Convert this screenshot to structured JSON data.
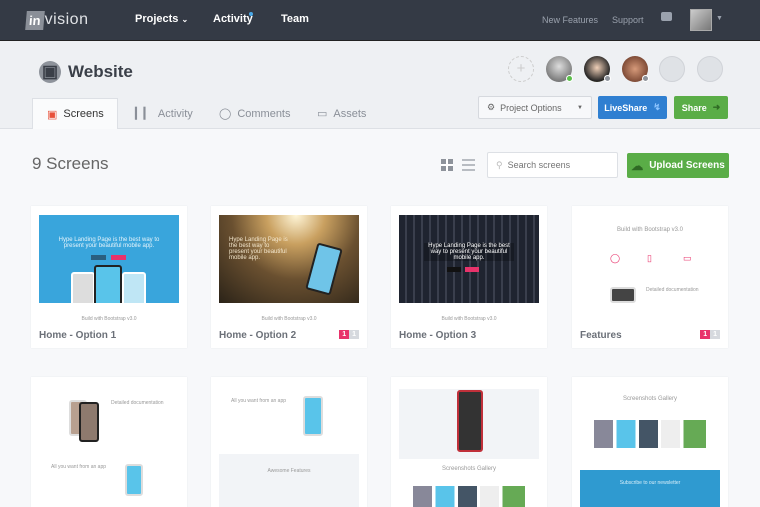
{
  "nav": {
    "logo_box": "in",
    "logo_text": "vision",
    "items": [
      {
        "label": "Projects",
        "icon": "chevron-down"
      },
      {
        "label": "Activity",
        "has_notification": true
      },
      {
        "label": "Team"
      }
    ],
    "right": [
      {
        "label": "New Features"
      },
      {
        "label": "Support"
      }
    ],
    "camera_icon": "camera-icon"
  },
  "project": {
    "title": "Website",
    "icon": "monitor-icon"
  },
  "collaborators": [
    {
      "status": "online",
      "status_color": "#5bbf4a"
    },
    {
      "status": "away",
      "status_color": "#8e939b"
    },
    {
      "status": "away",
      "status_color": "#8e939b"
    },
    {
      "status": "invited"
    },
    {
      "status": "invited"
    }
  ],
  "tabs": [
    {
      "label": "Screens",
      "icon": "monitor-icon",
      "active": true
    },
    {
      "label": "Activity",
      "icon": "bar-chart-icon"
    },
    {
      "label": "Comments",
      "icon": "comment-icon"
    },
    {
      "label": "Assets",
      "icon": "folder-icon"
    }
  ],
  "toolbar": {
    "project_options": "Project Options",
    "liveshare": "LiveShare",
    "share": "Share"
  },
  "screens": {
    "count_label": "9 Screens",
    "search_placeholder": "Search screens",
    "upload_label": "Upload Screens"
  },
  "colors": {
    "nav": "#343a45",
    "liveshare": "#2f7fd1",
    "share": "#5aad47",
    "badge": "#e8336b"
  },
  "cards": [
    {
      "title": "Home - Option 1",
      "thumb_text": "Hype Landing Page is the best way to present your beautiful mobile app.",
      "footer_text": "Build with Bootstrap v3.0"
    },
    {
      "title": "Home - Option 2",
      "thumb_text": "Hype Landing Page is the best way to present your beautiful mobile app.",
      "footer_text": "Build with Bootstrap v3.0",
      "badge": [
        "1",
        "1"
      ]
    },
    {
      "title": "Home - Option 3",
      "thumb_text": "Hype Landing Page is the best way to present your beautiful mobile app.",
      "footer_text": "Build with Bootstrap v3.0"
    },
    {
      "title": "Features",
      "thumb_text": "Build with Bootstrap v3.0",
      "footer_text": "Detailed documentation",
      "badge": [
        "1",
        "1"
      ]
    },
    {
      "thumb_text": "Detailed documentation",
      "footer_text": "All you want from an app"
    },
    {
      "thumb_text": "All you want from an app",
      "footer_text": "Awesome Features"
    },
    {
      "thumb_text": "Screenshots Gallery"
    },
    {
      "thumb_text": "Screenshots Gallery",
      "footer_text": "Subscribe to our newsletter"
    }
  ]
}
